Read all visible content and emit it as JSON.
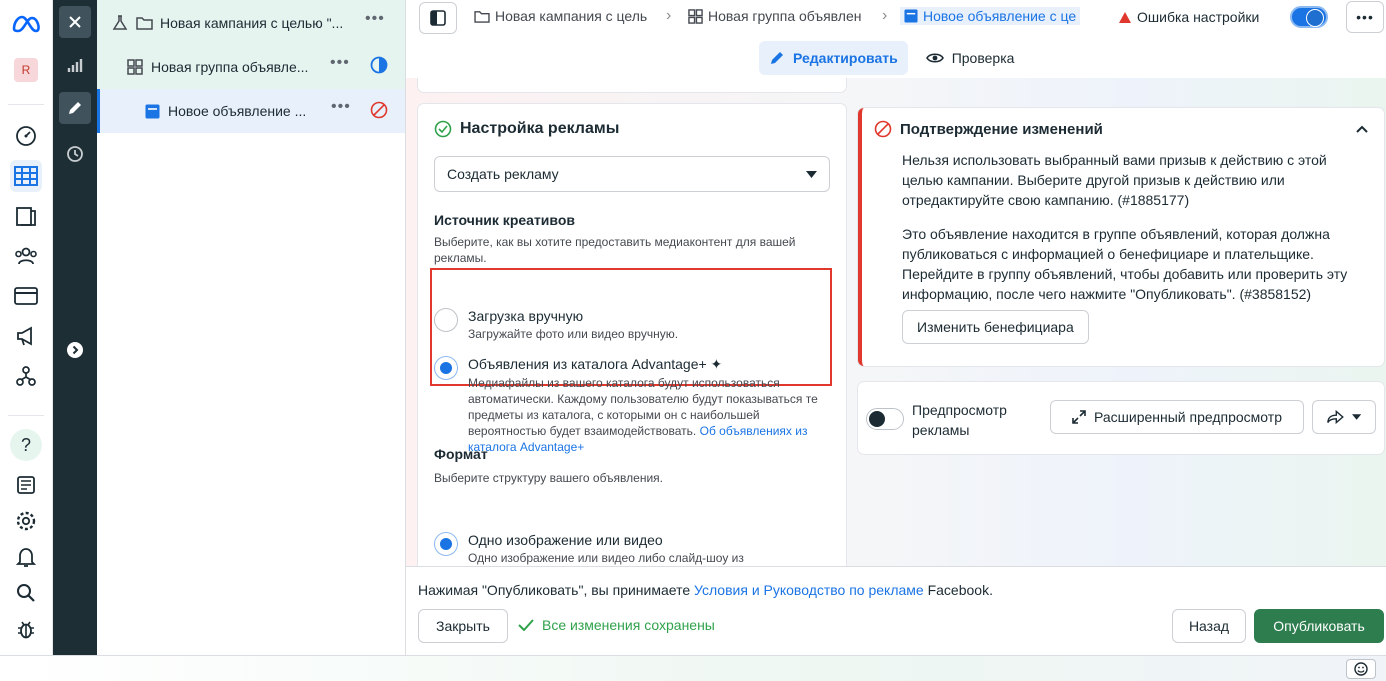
{
  "rail": {
    "avatar_letter": "R",
    "icons": [
      "dashboard-icon",
      "table-icon",
      "pages-icon",
      "people-icon",
      "billing-icon",
      "megaphone-icon",
      "network-icon",
      "help-icon",
      "news-icon",
      "settings-icon",
      "bell-icon",
      "search-icon",
      "bug-icon"
    ]
  },
  "tree": {
    "campaign": "Новая кампания с целью \"...",
    "adset": "Новая группа объявле...",
    "ad": "Новое объявление ..."
  },
  "topbar": {
    "crumbs": [
      "Новая кампания с цель",
      "Новая группа объявлен",
      "Новое объявление с це"
    ],
    "error_label": "Ошибка настройки"
  },
  "tabs": {
    "edit": "Редактировать",
    "review": "Проверка"
  },
  "setup": {
    "title": "Настройка рекламы",
    "select_value": "Создать рекламу",
    "source_title": "Источник креативов",
    "source_desc": "Выберите, как вы хотите предоставить медиаконтент для вашей рекламы.",
    "opt_manual_title": "Загрузка вручную",
    "opt_manual_desc": "Загружайте фото или видео вручную.",
    "opt_catalog_title": "Объявления из каталога Advantage+",
    "opt_catalog_desc": "Медиафайлы из вашего каталога будут использоваться автоматически. Каждому пользователю будут показываться те предметы из каталога, с которыми он с наибольшей вероятностью будет взаимодействовать.",
    "opt_catalog_link": "Об объявлениях из каталога Advantage+",
    "format_title": "Формат",
    "format_desc": "Выберите структуру вашего объявления.",
    "opt_single_title": "Одно изображение или видео",
    "opt_single_desc": "Одно изображение или видео либо слайд-шоу из нескольких изображений"
  },
  "confirm": {
    "title": "Подтверждение изменений",
    "p1": "Нельзя использовать выбранный вами призыв к действию с этой целью кампании. Выберите другой призыв к действию или отредактируйте свою кампанию. (#1885177)",
    "p2": "Это объявление находится в группе объявлений, которая должна публиковаться с информацией о бенефициаре и плательщике. Перейдите в группу объявлений, чтобы добавить или проверить эту информацию, после чего нажмите \"Опубликовать\". (#3858152)",
    "button": "Изменить бенефициара"
  },
  "preview": {
    "label_line1": "Предпросмотр",
    "label_line2": "рекламы",
    "advanced": "Расширенный предпросмотр"
  },
  "footer": {
    "note_prefix": "Нажимая \"Опубликовать\", вы принимаете ",
    "note_link": "Условия и Руководство по рекламе",
    "note_suffix": " Facebook.",
    "close": "Закрыть",
    "saved": "Все изменения сохранены",
    "back": "Назад",
    "publish": "Опубликовать"
  },
  "colors": {
    "accent": "#1b74e4",
    "error": "#e0382d",
    "publish": "#2e7d4f",
    "success": "#31a24c"
  }
}
